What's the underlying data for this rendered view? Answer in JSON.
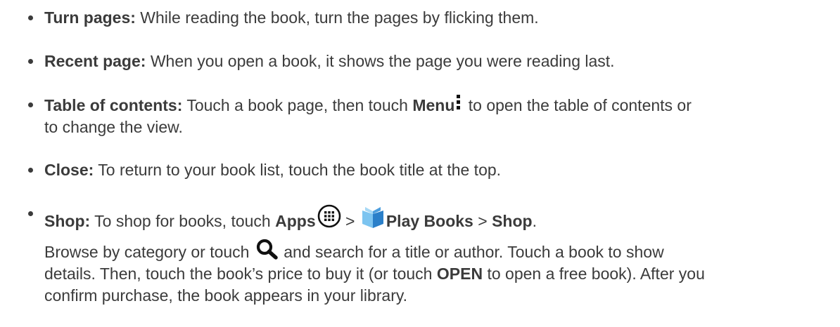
{
  "items": [
    {
      "title": "Turn pages:",
      "text": " While reading the book, turn the pages by flicking them."
    },
    {
      "title": "Recent page:",
      "text": " When you open a book, it shows the page you were reading last."
    },
    {
      "title": "Table of contents:",
      "text_before": " Touch a book page, then touch ",
      "menu_label": "Menu",
      "text_after_line1": " to open the table of contents or",
      "text_line2": "to change the view."
    },
    {
      "title": "Close:",
      "text": " To return to your book list, touch the book title at the top."
    },
    {
      "title": "Shop:",
      "text_before": " To shop for books, touch ",
      "apps_label": "Apps",
      "sep1": " > ",
      "play_books_label": "Play Books",
      "sep2": " > ",
      "shop_label": "Shop",
      "period": ".",
      "para_before": "Browse by category or touch ",
      "para_after_line1": " and search for a title or author. Touch a book to show",
      "para_line2_before": "details. Then, touch the book’s price to buy it (or touch ",
      "open_label": "OPEN",
      "para_line2_after": " to open a free book). After you",
      "para_line3": "confirm purchase, the book appears in your library."
    }
  ],
  "icons": {
    "menu": "menu-icon",
    "apps": "apps-icon",
    "play_books": "play-books-icon",
    "search": "search-icon",
    "books_light_blue": "#7cc4f0",
    "books_dark_blue": "#2a7fc9"
  }
}
